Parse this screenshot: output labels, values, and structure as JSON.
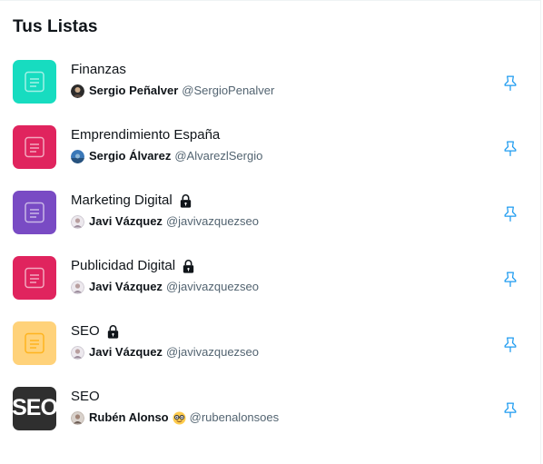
{
  "header": {
    "title": "Tus Listas"
  },
  "colors": {
    "accent": "#1d9bf0",
    "handle": "#536471"
  },
  "lists": [
    {
      "name": "Finanzas",
      "private": false,
      "owner": "Sergio Peñalver",
      "handle": "@SergioPenalver",
      "color": "#17dcc0"
    },
    {
      "name": "Emprendimiento España",
      "private": false,
      "owner": "Sergio Álvarez",
      "handle": "@AlvarezlSergio",
      "color": "#e0245e"
    },
    {
      "name": "Marketing Digital",
      "private": true,
      "owner": "Javi Vázquez",
      "handle": "@javivazquezseo",
      "color": "#794bc4"
    },
    {
      "name": "Publicidad Digital",
      "private": true,
      "owner": "Javi Vázquez",
      "handle": "@javivazquezseo",
      "color": "#e0245e"
    },
    {
      "name": "SEO",
      "private": true,
      "owner": "Javi Vázquez",
      "handle": "@javivazquezseo",
      "color": "#ffd27a"
    },
    {
      "name": "SEO",
      "private": false,
      "owner": "Rubén Alonso",
      "owner_emoji": "🤓",
      "handle": "@rubenalonsoes",
      "thumbnail_text": "SEO"
    }
  ]
}
